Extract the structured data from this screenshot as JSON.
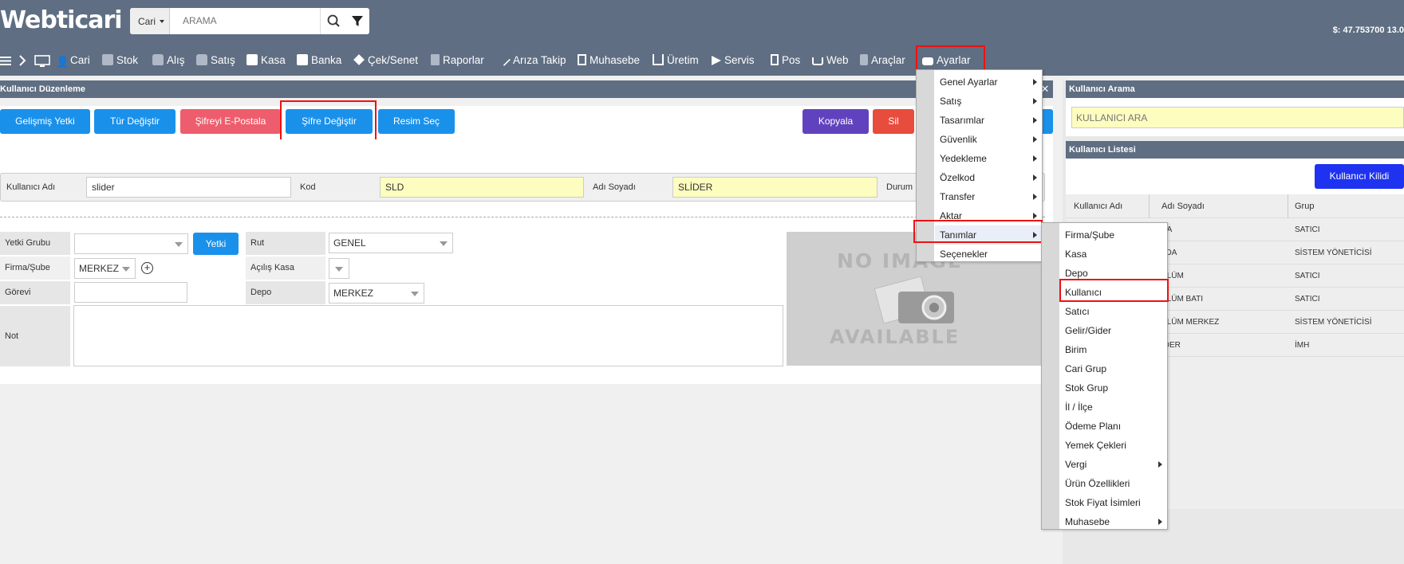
{
  "app": {
    "logo": "Webticari",
    "balance": "$: 47.753700   13.0"
  },
  "search": {
    "scope": "Cari",
    "placeholder": "ARAMA"
  },
  "nav": [
    {
      "label": "Cari",
      "icon": "user-icon"
    },
    {
      "label": "Stok",
      "icon": "cube-icon"
    },
    {
      "label": "Alış",
      "icon": "bag-icon"
    },
    {
      "label": "Satış",
      "icon": "bag-check-icon"
    },
    {
      "label": "Kasa",
      "icon": "wallet-icon"
    },
    {
      "label": "Banka",
      "icon": "bank-icon"
    },
    {
      "label": "Çek/Senet",
      "icon": "handshake-icon"
    },
    {
      "label": "Raporlar",
      "icon": "clipboard-icon"
    },
    {
      "label": "Arıza Takip",
      "icon": "wrench-icon"
    },
    {
      "label": "Muhasebe",
      "icon": "calculator-icon"
    },
    {
      "label": "Üretim",
      "icon": "factory-icon"
    },
    {
      "label": "Servis",
      "icon": "send-icon"
    },
    {
      "label": "Pos",
      "icon": "pos-icon"
    },
    {
      "label": "Web",
      "icon": "cart-icon"
    },
    {
      "label": "Araçlar",
      "icon": "tools-icon"
    },
    {
      "label": "Ayarlar",
      "icon": "toggle-icon"
    }
  ],
  "left_panel": {
    "title": "Kullanıcı Düzenleme",
    "buttons": {
      "advanced": "Gelişmiş Yetki",
      "change_type": "Tür Değiştir",
      "email_password": "Şifreyi E-Postala",
      "change_password": "Şifre Değiştir",
      "choose_image": "Resim Seç",
      "copy": "Kopyala",
      "delete": "Sil"
    },
    "fields": {
      "username_label": "Kullanıcı Adı",
      "username_value": "slider",
      "code_label": "Kod",
      "code_value": "SLD",
      "fullname_label": "Adı Soyadı",
      "fullname_value": "SLİDER",
      "status_label": "Durum",
      "auth_group_label": "Yetki Grubu",
      "auth_button": "Yetki",
      "route_label": "Rut",
      "route_value": "GENEL",
      "branch_label": "Firma/Şube",
      "branch_value": "MERKEZ",
      "opening_cash_label": "Açılış Kasa",
      "duty_label": "Görevi",
      "depot_label": "Depo",
      "depot_value": "MERKEZ",
      "note_label": "Not"
    },
    "no_image_top": "NO IMAGE",
    "no_image_bottom": "AVAILABLE"
  },
  "right_panel": {
    "search_title": "Kullanıcı Arama",
    "search_placeholder": "KULLANICI ARA",
    "list_title": "Kullanıcı Listesi",
    "lock_button": "Kullanıcı Kilidi",
    "columns": [
      "Kullanıcı Adı",
      "Adı Soyadı",
      "Grup"
    ],
    "rows": [
      {
        "name": "SA",
        "group": "SATICI"
      },
      {
        "name": "LDA",
        "group": "SİSTEM YÖNETİCİSİ"
      },
      {
        "name": "SLÜM",
        "group": "SATICI"
      },
      {
        "name": "SLÜM BATI",
        "group": "SATICI"
      },
      {
        "name": "SLÜM MERKEZ",
        "group": "SİSTEM YÖNETİCİSİ"
      },
      {
        "name": "İDER",
        "group": "İMH"
      }
    ]
  },
  "ayarlar_menu": [
    {
      "label": "Genel Ayarlar",
      "submenu": true
    },
    {
      "label": "Satış",
      "submenu": true
    },
    {
      "label": "Tasarımlar",
      "submenu": true
    },
    {
      "label": "Güvenlik",
      "submenu": true
    },
    {
      "label": "Yedekleme",
      "submenu": true
    },
    {
      "label": "Özelkod",
      "submenu": true
    },
    {
      "label": "Transfer",
      "submenu": true
    },
    {
      "label": "Aktar",
      "submenu": true
    },
    {
      "label": "Tanımlar",
      "submenu": true
    },
    {
      "label": "Seçenekler",
      "submenu": false
    }
  ],
  "tanimlar_menu": [
    {
      "label": "Firma/Şube",
      "submenu": false
    },
    {
      "label": "Kasa",
      "submenu": false
    },
    {
      "label": "Depo",
      "submenu": false
    },
    {
      "label": "Kullanıcı",
      "submenu": false
    },
    {
      "label": "Satıcı",
      "submenu": false
    },
    {
      "label": "Gelir/Gider",
      "submenu": false
    },
    {
      "label": "Birim",
      "submenu": false
    },
    {
      "label": "Cari Grup",
      "submenu": false
    },
    {
      "label": "Stok Grup",
      "submenu": false
    },
    {
      "label": "İl / İlçe",
      "submenu": false
    },
    {
      "label": "Ödeme Planı",
      "submenu": false
    },
    {
      "label": "Yemek Çekleri",
      "submenu": false
    },
    {
      "label": "Vergi",
      "submenu": true
    },
    {
      "label": "Ürün Özellikleri",
      "submenu": false
    },
    {
      "label": "Stok Fiyat İsimleri",
      "submenu": false
    },
    {
      "label": "Muhasebe",
      "submenu": true
    }
  ]
}
